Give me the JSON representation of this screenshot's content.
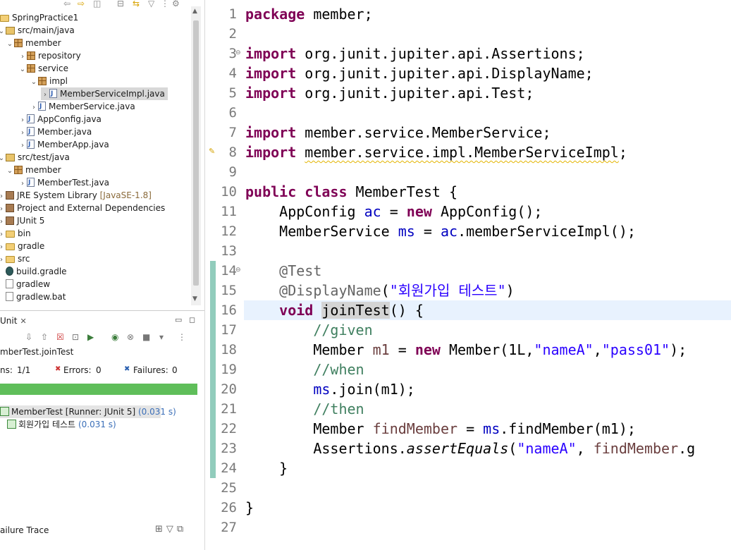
{
  "package_explorer": {
    "items": [
      {
        "label": "SpringPractice1"
      },
      {
        "label": "src/main/java"
      },
      {
        "label": "member"
      },
      {
        "label": "repository"
      },
      {
        "label": "service"
      },
      {
        "label": "impl"
      },
      {
        "label": "MemberServiceImpl.java"
      },
      {
        "label": "MemberService.java"
      },
      {
        "label": "AppConfig.java"
      },
      {
        "label": "Member.java"
      },
      {
        "label": "MemberApp.java"
      },
      {
        "label": "src/test/java"
      },
      {
        "label": "member"
      },
      {
        "label": "MemberTest.java"
      },
      {
        "label": "JRE System Library",
        "decoration": "[JavaSE-1.8]"
      },
      {
        "label": "Project and External Dependencies"
      },
      {
        "label": "JUnit 5"
      },
      {
        "label": "bin"
      },
      {
        "label": "gradle"
      },
      {
        "label": "src"
      },
      {
        "label": "build.gradle"
      },
      {
        "label": "gradlew"
      },
      {
        "label": "gradlew.bat"
      }
    ]
  },
  "junit": {
    "tab_label": "Unit",
    "test_name": "mberTest.joinTest",
    "runs_label": "ns:",
    "runs_value": "1/1",
    "errors_label": "Errors:",
    "errors_value": "0",
    "failures_label": "Failures:",
    "failures_value": "0",
    "progress": 1.0,
    "progress_color": "#5fbe5a",
    "results": [
      {
        "label": "MemberTest [Runner: JUnit 5]",
        "time": "(0.031 s)"
      },
      {
        "label": "회원가입 테스트",
        "time": "(0.031 s)"
      }
    ],
    "failure_trace_label": "ailure Trace"
  },
  "editor": {
    "line_numbers": [
      "1",
      "2",
      "3",
      "4",
      "5",
      "6",
      "7",
      "8",
      "9",
      "10",
      "11",
      "12",
      "13",
      "14",
      "15",
      "16",
      "17",
      "18",
      "19",
      "20",
      "21",
      "22",
      "23",
      "24",
      "25",
      "26",
      "27"
    ],
    "current_line": "16",
    "tokens": {
      "package": "package",
      "member_pkg": " member;",
      "import": "import",
      "imp1": " org.junit.jupiter.api.Assertions;",
      "imp2": " org.junit.jupiter.api.DisplayName;",
      "imp3": " org.junit.jupiter.api.Test;",
      "imp4": " member.service.MemberService;",
      "imp5_pre": " ",
      "imp5": "member.service.impl.MemberServiceImpl",
      "semi": ";",
      "public": "public",
      "class": "class",
      "class_name": " MemberTest {",
      "l11_type": "    AppConfig ",
      "ac": "ac",
      "eq": " = ",
      "new": "new",
      "l11_rest": " AppConfig();",
      "l12_type": "    MemberService ",
      "ms": "ms",
      "dot_call": ".memberServiceImpl();",
      "at_test": "    @Test",
      "at_dn": "    @DisplayName",
      "paren_open": "(",
      "dn_str": "\"회원가입 테스트\"",
      "paren_close": ")",
      "indent4": "    ",
      "void": "void",
      "sp": " ",
      "join_test": "joinTest",
      "join_rest": "() {",
      "given": "        //given",
      "l18_pre": "        Member ",
      "m1": "m1",
      "l18_mid": " Member(1L,",
      "nameA": "\"nameA\"",
      "comma": ",",
      "pass01": "\"pass01\"",
      "l18_end": ");",
      "when": "        //when",
      "indent8": "        ",
      "join_call": ".join(m1);",
      "then": "        //then",
      "l22_pre": "        Member ",
      "find_member": "findMember",
      "find_call": ".findMember(m1);",
      "l23_pre": "        Assertions.",
      "assert_eq": "assertEquals",
      "comma_sp": ", ",
      "l23_rest": ".g",
      "close_method": "    }",
      "close_class": "}"
    }
  }
}
